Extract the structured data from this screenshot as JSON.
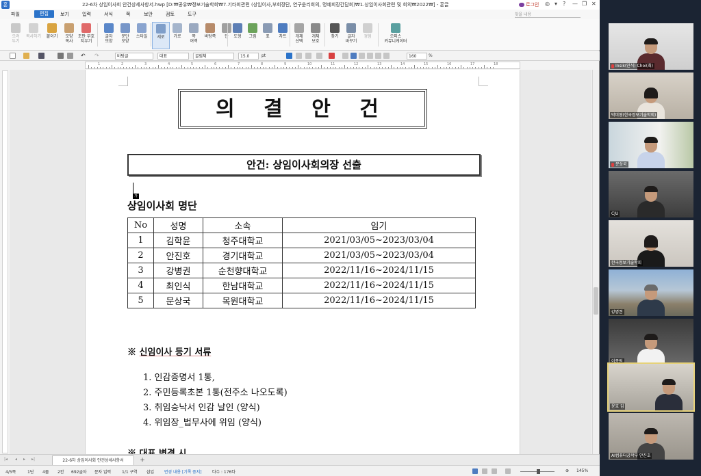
{
  "window": {
    "title": "22-6차 상임이사회 안건상세사항서.hwp [D:₩공유₩정보기술학회₩7.기타회관련 (상임이사,부회장단, 연구윤리회의, 명예회장간담회)₩1.상임이사회관련 및 회의₩2022₩] - 훈글",
    "login": "로그인",
    "controls": [
      "◎",
      "▾",
      "?",
      "—",
      "❐",
      "✕"
    ]
  },
  "menu": {
    "items": [
      "파일",
      "편집",
      "보기",
      "입력",
      "서식",
      "쪽",
      "보안",
      "검토",
      "도구"
    ],
    "active": "편집",
    "search_placeholder": "찾을 내용"
  },
  "ribbon": {
    "buttons": [
      {
        "label": "오려\n두기"
      },
      {
        "label": "복사하기"
      },
      {
        "label": "붙이기"
      },
      {
        "label": "모양\n복사"
      },
      {
        "label": "조판 부호\n지우기"
      },
      {
        "label": "글자\n모양"
      },
      {
        "label": "문단\n모양"
      },
      {
        "label": "스타일"
      },
      {
        "label": "세로"
      },
      {
        "label": "가로"
      },
      {
        "label": "쪽\n여백"
      },
      {
        "label": "바탕쪽"
      },
      {
        "label": "단"
      },
      {
        "label": "도형"
      },
      {
        "label": "그림"
      },
      {
        "label": "표"
      },
      {
        "label": "차트"
      },
      {
        "label": "개체\n선택"
      },
      {
        "label": "개체\n보호"
      },
      {
        "label": "찾기"
      },
      {
        "label": "글자\n바꾸기"
      },
      {
        "label": "경험"
      },
      {
        "label": "오피스\n커뮤니케이터"
      }
    ]
  },
  "format": {
    "style": "바탕글",
    "lang": "대표",
    "font": "굴림체",
    "size": "15.0",
    "unit": "pt",
    "zoom": "160",
    "zoom_unit": "%"
  },
  "ruler": {
    "numbers": [
      "1",
      "2",
      "3",
      "4",
      "5",
      "6",
      "7",
      "8",
      "9",
      "10",
      "11",
      "12",
      "13",
      "14",
      "15",
      "16",
      "17",
      "18"
    ]
  },
  "document": {
    "heading": "의 결 안 건",
    "agenda": "안건: 상임이사회의장 선출",
    "cursor_mark": "가",
    "board_title": "상임이사회 명단",
    "table_headers": [
      "No",
      "성명",
      "소속",
      "임기"
    ],
    "table_rows": [
      [
        "1",
        "김학윤",
        "청주대학교",
        "2021/03/05~2023/03/04"
      ],
      [
        "2",
        "안진호",
        "경기대학교",
        "2021/03/05~2023/03/04"
      ],
      [
        "3",
        "강병권",
        "순천향대학교",
        "2022/11/16~2024/11/15"
      ],
      [
        "4",
        "최인식",
        "한남대학교",
        "2022/11/16~2024/11/15"
      ],
      [
        "5",
        "문상국",
        "목원대학교",
        "2022/11/16~2024/11/15"
      ]
    ],
    "reg_mark": "※",
    "reg_title": "신임이사 등기 서류",
    "reg_items": [
      "1. 인감증명서 1통,",
      "2. 주민등록초본 1통(전주소 나오도록)",
      "3. 취임승낙서 인감 날인 (양식)",
      "4. 위임장_법무사에 위임 (양식)"
    ],
    "rep_heading": "※ 대표 변경 시"
  },
  "tabs": {
    "doc_tab": "22-6차 상임이사회 안건상세사항서",
    "add": "+"
  },
  "status": {
    "page": "4/5쪽",
    "section": "1단",
    "line": "4줄",
    "col": "2칸",
    "chars": "692글자",
    "mode": "문자 입력",
    "area": "1/1 구역",
    "insert": "삽입",
    "track": "변경 내용 [기록 중지]",
    "strokes": "타수 : 176타",
    "zoom": "145%"
  },
  "participants": [
    {
      "name": "Insik(인식) Choi(최)",
      "muted": true
    },
    {
      "name": "박미영(한국정보기술학회)",
      "muted": false
    },
    {
      "name": "문상국",
      "muted": true
    },
    {
      "name": "CJU",
      "muted": false
    },
    {
      "name": "한국정보기술학회",
      "muted": false
    },
    {
      "name": "강병권",
      "muted": false
    },
    {
      "name": "이종원",
      "muted": false
    },
    {
      "name": "윤호 김",
      "muted": false
    },
    {
      "name": "AI컴퓨터공학부 안진호",
      "muted": false
    }
  ]
}
